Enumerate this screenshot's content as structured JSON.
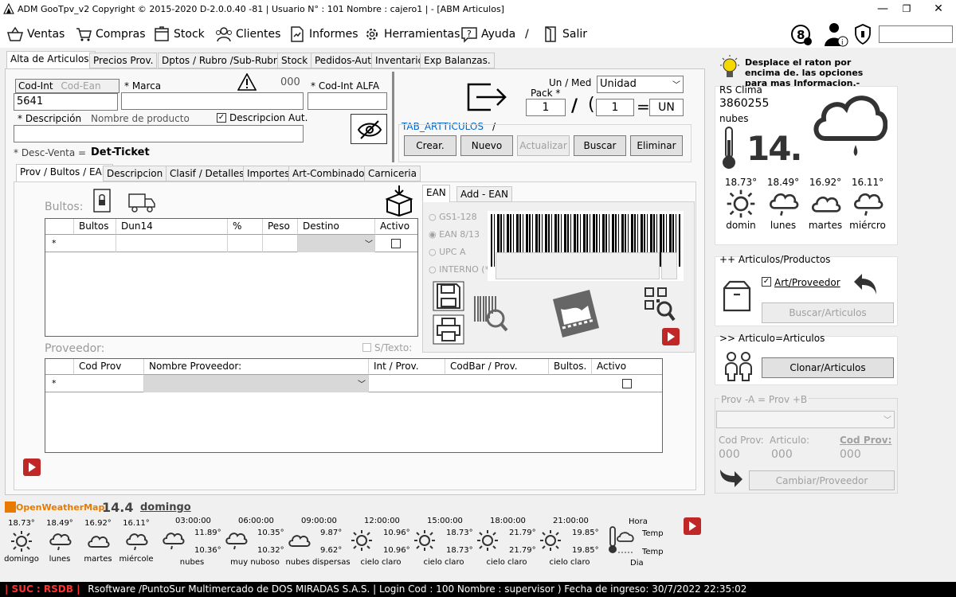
{
  "window": {
    "title": "ADM GooTpv_v2 Copyright ©  2015-2020 D-2.0.0.40 -81 | Usuario N° : 101 Nombre : cajero1 | - [ABM Articulos]"
  },
  "menu": {
    "items": [
      "Ventas",
      "Compras",
      "Stock",
      "Clientes",
      "Informes",
      "Herramientas",
      "Ayuda",
      "/",
      "Salir"
    ]
  },
  "tabs": [
    "Alta de Articulos.",
    "Precios Prov.",
    "Dptos / Rubro /Sub-Rubro:",
    "Stock",
    "Pedidos-Aut",
    "Inventario",
    "Exp Balanzas."
  ],
  "form": {
    "codint_label": "Cod-Int",
    "codean_label": "Cod-Ean",
    "codint_value": "5641",
    "marca_label": "* Marca",
    "warn_code": "000",
    "codalfa_label": "* Cod-Int ALFA",
    "descripcion_label": "* Descripción",
    "nombre_label": "Nombre de producto",
    "descaut_label": "Descripcion Aut.",
    "descventa_label": "* Desc-Venta =",
    "descventa_value": "Det-Ticket",
    "unmed_label": "Un / Med",
    "pack_label": "Pack *",
    "unidad_value": "Unidad",
    "pack_value": "1",
    "pack2_value": "1",
    "un_value": "UN",
    "tab_label": "TAB_ARTTICULOS",
    "tab_sep": "/",
    "buttons": {
      "crear": "Crear.",
      "nuevo": "Nuevo",
      "actualizar": "Actualizar",
      "buscar": "Buscar",
      "eliminar": "Eliminar"
    }
  },
  "subtabs": [
    "Prov / Bultos / EAN",
    "Descripcion",
    "Clasif / Detalles",
    "Importes",
    "Art-Combinados",
    "Carniceria"
  ],
  "bultos": {
    "label": "Bultos:",
    "columns": [
      "Bultos",
      "Dun14",
      "%",
      "Peso",
      "Destino",
      "Activo"
    ],
    "row_marker": "*"
  },
  "ean": {
    "tabs": [
      "EAN",
      "Add - EAN"
    ],
    "options": [
      "GS1-128",
      "EAN 8/13",
      "UPC A",
      "INTERNO (*)"
    ]
  },
  "proveedor": {
    "label": "Proveedor:",
    "stexto": "S/Texto:",
    "columns": [
      "Cod Prov",
      "Nombre Proveedor:",
      "Int / Prov.",
      "CodBar / Prov.",
      "Bultos.",
      "Activo"
    ],
    "row_marker": "*"
  },
  "right": {
    "hint": "Desplace el raton por encima de. las opciones para mas Informacion.-",
    "clima_label": "RS Clima",
    "clima_code": "3860255",
    "clima_desc": "nubes",
    "temp": "14.",
    "forecast": [
      {
        "t": "18.73°",
        "d": "domin",
        "icon": "sun-icon"
      },
      {
        "t": "18.49°",
        "d": "lunes",
        "icon": "cloud-rain-icon"
      },
      {
        "t": "16.92°",
        "d": "martes",
        "icon": "cloud-icon"
      },
      {
        "t": "16.11°",
        "d": "miércro",
        "icon": "cloud-rain-icon"
      }
    ],
    "articulos_title": "++ Articulos/Productos",
    "artprov_label": "Art/Proveedor",
    "buscar_articulos": "Buscar/Articulos",
    "clonar_title": ">> Articulo=Articulos",
    "clonar_btn": "Clonar/Articulos",
    "prov_title": "Prov -A = Prov +B",
    "codprov_label": "Cod Prov:",
    "articulo_label": "Articulo:",
    "codprov2_label": "Cod Prov:",
    "codprov_value": "000",
    "articulo_value": "000",
    "codprov2_value": "000",
    "cambiar_btn": "Cambiar/Proveedor"
  },
  "weather_strip": {
    "brand": "OpenWeatherMap",
    "temp": "14.4",
    "day": "domingo",
    "days": [
      {
        "t": "18.73°",
        "d": "domingo",
        "icon": "sun-icon"
      },
      {
        "t": "18.49°",
        "d": "lunes",
        "icon": "cloud-rain-icon"
      },
      {
        "t": "16.92°",
        "d": "martes",
        "icon": "cloud-icon"
      },
      {
        "t": "16.11°",
        "d": "miércole",
        "icon": "cloud-rain-icon"
      }
    ],
    "hours": [
      {
        "h": "03:00:00",
        "hi": "11.89°",
        "lo": "10.36°",
        "d": "nubes",
        "icon": "cloud-rain-icon"
      },
      {
        "h": "06:00:00",
        "hi": "10.35°",
        "lo": "10.32°",
        "d": "muy nuboso",
        "icon": "cloud-rain-icon"
      },
      {
        "h": "09:00:00",
        "hi": "9.87°",
        "lo": "9.62°",
        "d": "nubes dispersas",
        "icon": "cloud-icon"
      },
      {
        "h": "12:00:00",
        "hi": "10.96°",
        "lo": "10.96°",
        "d": "cielo claro",
        "icon": "sun-icon"
      },
      {
        "h": "15:00:00",
        "hi": "18.73°",
        "lo": "18.73°",
        "d": "cielo claro",
        "icon": "sun-icon"
      },
      {
        "h": "18:00:00",
        "hi": "21.79°",
        "lo": "21.79°",
        "d": "cielo claro",
        "icon": "sun-icon"
      },
      {
        "h": "21:00:00",
        "hi": "19.85°",
        "lo": "19.85°",
        "d": "cielo claro",
        "icon": "sun-icon"
      }
    ],
    "hora_label": "Hora",
    "temp_label": "Temp",
    "temp2_label": "Temp",
    "dia_label": "Dia"
  },
  "status": {
    "suc": "| SUC : RSDB |",
    "text": "Rsoftware /PuntoSur Multimercado de DOS MIRADAS S.A.S. | Login Cod : 100 Nombre : supervisor ) Fecha de ingreso: 30/7/2022 22:35:02"
  },
  "colors": {
    "accent": "#0066cc",
    "red": "#c02828",
    "status_red": "#ff3030",
    "orange": "#e87a00"
  }
}
